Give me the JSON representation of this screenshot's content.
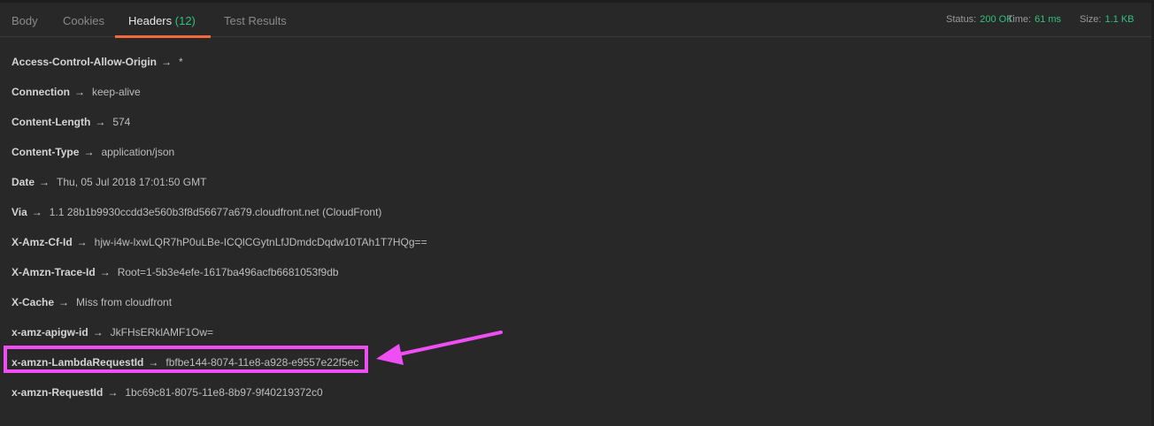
{
  "tabs": [
    {
      "label": "Body",
      "count": ""
    },
    {
      "label": "Cookies",
      "count": ""
    },
    {
      "label": "Headers",
      "count": "(12)"
    },
    {
      "label": "Test Results",
      "count": ""
    }
  ],
  "status": {
    "status_label": "Status:",
    "status_value": "200 OK",
    "time_label": "Time:",
    "time_value": "61 ms",
    "size_label": "Size:",
    "size_value": "1.1 KB"
  },
  "arrow_glyph": "→",
  "headers": [
    {
      "key": "Access-Control-Allow-Origin",
      "value": "*"
    },
    {
      "key": "Connection",
      "value": "keep-alive"
    },
    {
      "key": "Content-Length",
      "value": "574"
    },
    {
      "key": "Content-Type",
      "value": "application/json"
    },
    {
      "key": "Date",
      "value": "Thu, 05 Jul 2018 17:01:50 GMT"
    },
    {
      "key": "Via",
      "value": "1.1 28b1b9930ccdd3e560b3f8d56677a679.cloudfront.net (CloudFront)"
    },
    {
      "key": "X-Amz-Cf-Id",
      "value": "hjw-i4w-lxwLQR7hP0uLBe-ICQlCGytnLfJDmdcDqdw10TAh1T7HQg=="
    },
    {
      "key": "X-Amzn-Trace-Id",
      "value": "Root=1-5b3e4efe-1617ba496acfb6681053f9db"
    },
    {
      "key": "X-Cache",
      "value": "Miss from cloudfront"
    },
    {
      "key": "x-amz-apigw-id",
      "value": "JkFHsERklAMF1Ow="
    },
    {
      "key": "x-amzn-LambdaRequestId",
      "value": "fbfbe144-8074-11e8-a928-e9557e22f5ec"
    },
    {
      "key": "x-amzn-RequestId",
      "value": "1bc69c81-8075-11e8-8b97-9f40219372c0"
    }
  ],
  "annotation": {
    "color": "#f04ef5",
    "highlight_icon": "highlight-box",
    "pointer_icon": "pointer-arrow-icon"
  }
}
